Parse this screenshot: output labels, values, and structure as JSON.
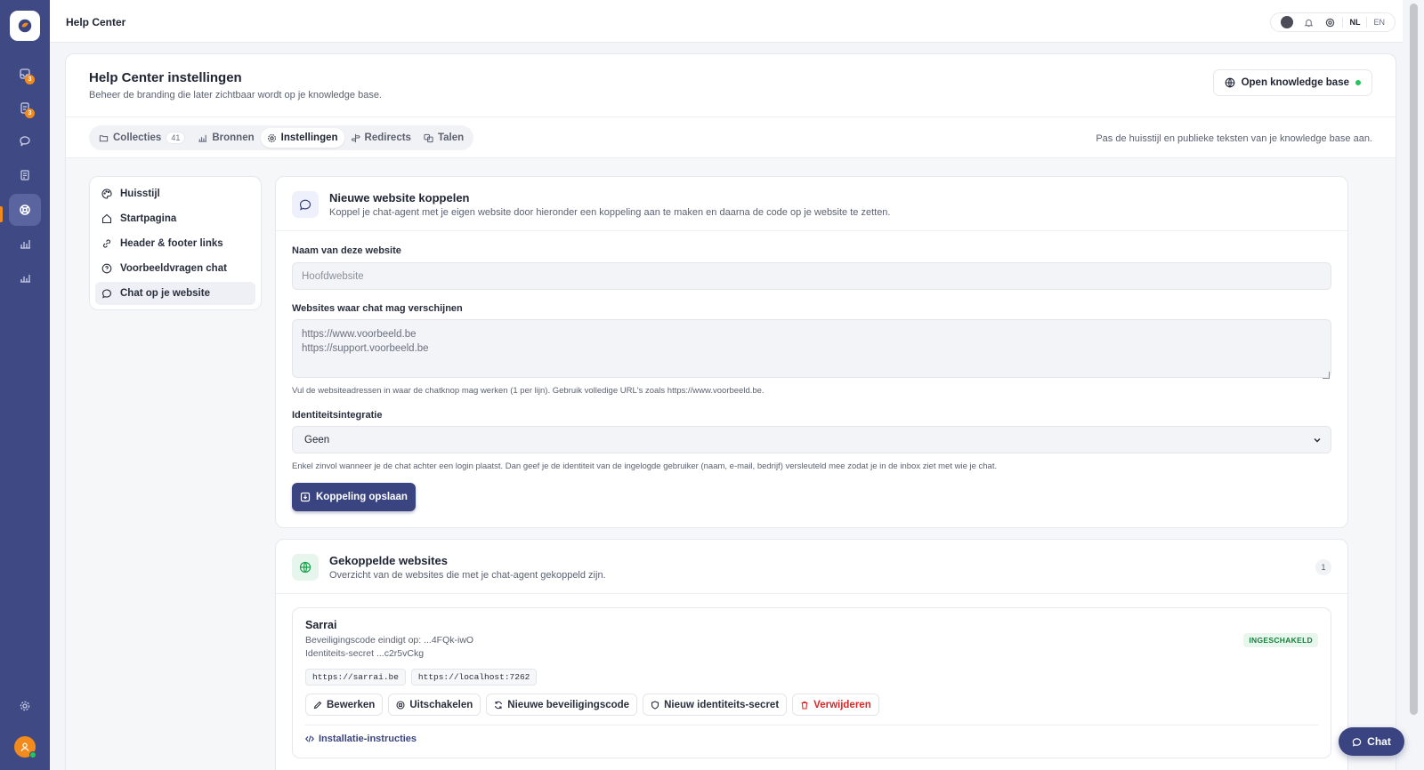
{
  "topbar": {
    "title": "Help Center"
  },
  "languages": [
    "NL",
    "EN"
  ],
  "rail": {
    "badges": [
      "3",
      "3"
    ],
    "accent": "#f28a1c",
    "background": "#3f4a84"
  },
  "header": {
    "title": "Help Center instellingen",
    "subtitle": "Beheer de branding die later zichtbaar wordt op je knowledge base.",
    "open_kb_label": "Open knowledge base"
  },
  "tabs": [
    {
      "label": "Collecties",
      "count": "41",
      "icon": "folder-icon"
    },
    {
      "label": "Bronnen",
      "icon": "bar-chart-icon"
    },
    {
      "label": "Instellingen",
      "icon": "gear-icon",
      "active": true
    },
    {
      "label": "Redirects",
      "icon": "signpost-icon"
    },
    {
      "label": "Talen",
      "icon": "translate-icon"
    }
  ],
  "tabs_hint": "Pas de huisstijl en publieke teksten van je knowledge base aan.",
  "side_nav": [
    {
      "label": "Huisstijl",
      "icon": "palette-icon"
    },
    {
      "label": "Startpagina",
      "icon": "home-icon"
    },
    {
      "label": "Header & footer links",
      "icon": "link-icon"
    },
    {
      "label": "Voorbeeldvragen chat",
      "icon": "chat-question-icon"
    },
    {
      "label": "Chat op je website",
      "icon": "chat-icon",
      "active": true
    }
  ],
  "new_website": {
    "title": "Nieuwe website koppelen",
    "subtitle": "Koppel je chat-agent met je eigen website door hieronder een koppeling aan te maken en daarna de code op je website te zetten.",
    "name_label": "Naam van deze website",
    "name_placeholder": "Hoofdwebsite",
    "sites_label": "Websites waar chat mag verschijnen",
    "sites_placeholder": "https://www.voorbeeld.be\nhttps://support.voorbeeld.be",
    "sites_help": "Vul de websiteadressen in waar de chatknop mag werken (1 per lijn). Gebruik volledige URL's zoals https://www.voorbeeld.be.",
    "identity_label": "Identiteitsintegratie",
    "identity_value": "Geen",
    "identity_help": "Enkel zinvol wanneer je de chat achter een login plaatst. Dan geef je de identiteit van de ingelogde gebruiker (naam, e-mail, bedrijf) versleuteld mee zodat je in de inbox ziet met wie je chat.",
    "save_label": "Koppeling opslaan"
  },
  "linked": {
    "title": "Gekoppelde websites",
    "subtitle": "Overzicht van de websites die met je chat-agent gekoppeld zijn.",
    "count": "1",
    "site": {
      "name": "Sarrai",
      "security_code": "Beveiligingscode eindigt op: ...4FQk-iwO",
      "identity_secret": "Identiteits-secret ...c2r5vCkg",
      "status": "INGESCHAKELD",
      "urls": [
        "https://sarrai.be",
        "https://localhost:7262"
      ],
      "actions": {
        "edit": "Bewerken",
        "disable": "Uitschakelen",
        "new_code": "Nieuwe beveiligingscode",
        "new_secret": "Nieuw identiteits-secret",
        "delete": "Verwijderen"
      },
      "install_label": "Installatie-instructies"
    }
  },
  "chat_fab": {
    "label": "Chat"
  }
}
